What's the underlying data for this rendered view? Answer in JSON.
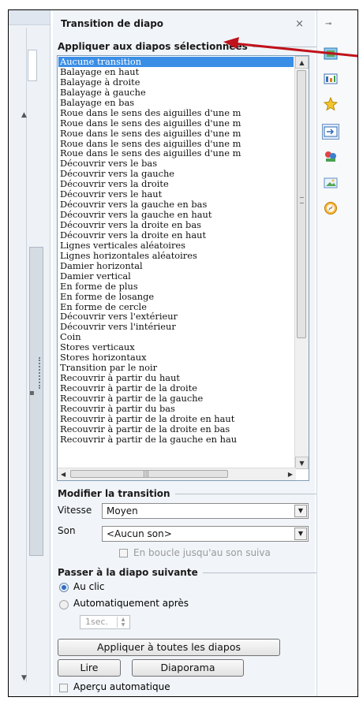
{
  "panel": {
    "title": "Transition de diapo",
    "close_glyph": "×"
  },
  "apply_section": {
    "label": "Appliquer aux diapos sélectionnées",
    "transitions": [
      "Aucune transition",
      "Balayage en haut",
      "Balayage à droite",
      "Balayage à gauche",
      "Balayage en bas",
      "Roue dans le sens des aiguilles d'une m",
      "Roue dans le sens des aiguilles d'une m",
      "Roue dans le sens des aiguilles d'une m",
      "Roue dans le sens des aiguilles d'une m",
      "Roue dans le sens des aiguilles d'une m",
      "Découvrir vers le bas",
      "Découvrir vers la gauche",
      "Découvrir vers la droite",
      "Découvrir vers le haut",
      "Découvrir vers la gauche en bas",
      "Découvrir vers la gauche en haut",
      "Découvrir vers la droite en bas",
      "Découvrir vers la droite en haut",
      "Lignes verticales aléatoires",
      "Lignes horizontales aléatoires",
      "Damier horizontal",
      "Damier vertical",
      "En forme de plus",
      "En forme de losange",
      "En forme de cercle",
      "Découvrir vers l'extérieur",
      "Découvrir vers l'intérieur",
      "Coin",
      "Stores verticaux",
      "Stores horizontaux",
      "Transition par le noir",
      "Recouvrir à partir du haut",
      "Recouvrir à partir de la droite",
      "Recouvrir à partir de la gauche",
      "Recouvrir à partir du bas",
      "Recouvrir à partir de la droite en haut",
      "Recouvrir à partir de la droite en bas",
      "Recouvrir à partir de la gauche en hau"
    ],
    "selected_index": 0
  },
  "modify_section": {
    "label": "Modifier la transition",
    "speed_label": "Vitesse",
    "speed_value": "Moyen",
    "sound_label": "Son",
    "sound_value": "<Aucun son>",
    "loop_label": "En boucle jusqu'au son suiva",
    "loop_checked": false
  },
  "next_section": {
    "label": "Passer à la diapo suivante",
    "on_click_label": "Au clic",
    "auto_label": "Automatiquement après",
    "selected": "Au clic",
    "delay_value": "1sec."
  },
  "buttons": {
    "apply_all": "Appliquer à toutes les diapos",
    "play": "Lire",
    "slideshow": "Diaporama"
  },
  "preview": {
    "label": "Aperçu automatique",
    "checked": false
  },
  "annotation": {
    "arrow_color": "#c0121b"
  }
}
